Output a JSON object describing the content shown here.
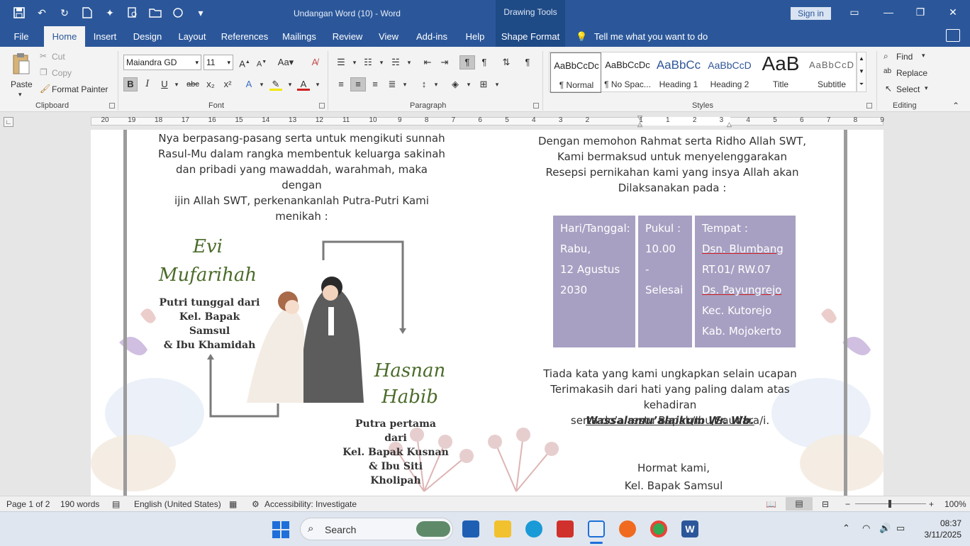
{
  "window": {
    "title": "Undangan Word (10)  -  Word",
    "contextual_tab_group": "Drawing Tools",
    "sign_in": "Sign in"
  },
  "tabs": [
    "File",
    "Home",
    "Insert",
    "Design",
    "Layout",
    "References",
    "Mailings",
    "Review",
    "View",
    "Add-ins",
    "Help",
    "Shape Format"
  ],
  "tell_me": "Tell me what you want to do",
  "clipboard": {
    "paste": "Paste",
    "cut": "Cut",
    "copy": "Copy",
    "format_painter": "Format Painter",
    "label": "Clipboard"
  },
  "font": {
    "family": "Maiandra GD",
    "size": "11",
    "label": "Font",
    "bold": "B",
    "italic": "I",
    "underline": "U",
    "strike": "abc",
    "subscript": "x₂",
    "superscript": "x²"
  },
  "paragraph": {
    "label": "Paragraph"
  },
  "styles": {
    "label": "Styles",
    "items": [
      {
        "sample": "AaBbCcDc",
        "name": "¶ Normal"
      },
      {
        "sample": "AaBbCcDc",
        "name": "¶ No Spac..."
      },
      {
        "sample": "AaBbCc",
        "name": "Heading 1"
      },
      {
        "sample": "AaBbCcD",
        "name": "Heading 2"
      },
      {
        "sample": "AaB",
        "name": "Title"
      },
      {
        "sample": "AaBbCcD",
        "name": "Subtitle"
      }
    ]
  },
  "editing": {
    "label": "Editing",
    "find": "Find",
    "replace": "Replace",
    "select": "Select"
  },
  "ruler": {
    "numbers": [
      "20",
      "19",
      "18",
      "17",
      "16",
      "15",
      "14",
      "13",
      "12",
      "11",
      "10",
      "9",
      "8",
      "7",
      "6",
      "5",
      "4",
      "3",
      "2",
      "1",
      "1",
      "2",
      "3",
      "4",
      "5",
      "6",
      "7",
      "8",
      "9"
    ]
  },
  "document": {
    "left_intro": [
      "Nya berpasang-pasang serta untuk mengikuti sunnah",
      "Rasul-Mu dalam rangka membentuk keluarga sakinah",
      "dan pribadi yang mawaddah, warahmah, maka dengan",
      "ijin Allah SWT, perkenankanlah Putra-Putri Kami",
      "menikah :"
    ],
    "bride": {
      "first": "Evi",
      "last": "Mufarihah",
      "family": [
        "Putri tunggal dari",
        "Kel. Bapak Samsul",
        "& Ibu Khamidah"
      ]
    },
    "groom": {
      "first": "Hasnan",
      "last": "Habib",
      "family": [
        "Putra pertama dari",
        "Kel. Bapak Kusnan",
        "& Ibu Siti Kholipah"
      ]
    },
    "right_intro": [
      "Dengan memohon Rahmat serta Ridho Allah SWT,",
      "Kami bermaksud untuk menyelenggarakan",
      "Resepsi pernikahan kami yang insya Allah akan",
      "Dilaksanakan pada :"
    ],
    "table": {
      "col1": [
        "Hari/Tanggal:",
        "Rabu,",
        "12 Agustus",
        "2030"
      ],
      "col2": [
        "Pukul  :",
        "10.00",
        "- Selesai"
      ],
      "col3": [
        "Tempat  :",
        "Dsn. Blumbang",
        "RT.01/ RW.07",
        "Ds. Payungrejo",
        "Kec. Kutorejo",
        "Kab. Mojokerto"
      ]
    },
    "closing": [
      "Tiada kata yang kami ungkapkan selain ucapan",
      "Terimakasih dari hati yang paling dalam atas kehadiran",
      "serta do’a restu Bapak/Ibu/Saudara/i."
    ],
    "salam": "Wassalamu’alaikum Wr. Wb.",
    "hormat": "Hormat kami,",
    "signature": "Kel. Bapak Samsul"
  },
  "status": {
    "page": "Page 1 of 2",
    "words": "190 words",
    "language": "English (United States)",
    "accessibility": "Accessibility: Investigate",
    "zoom": "100%"
  },
  "taskbar": {
    "search": "Search",
    "time": "08:37",
    "date": "3/11/2025"
  },
  "colors": {
    "title_bar": "#2b579a",
    "table_fill": "#a8a0c2",
    "script_green": "#4b6b2a"
  }
}
